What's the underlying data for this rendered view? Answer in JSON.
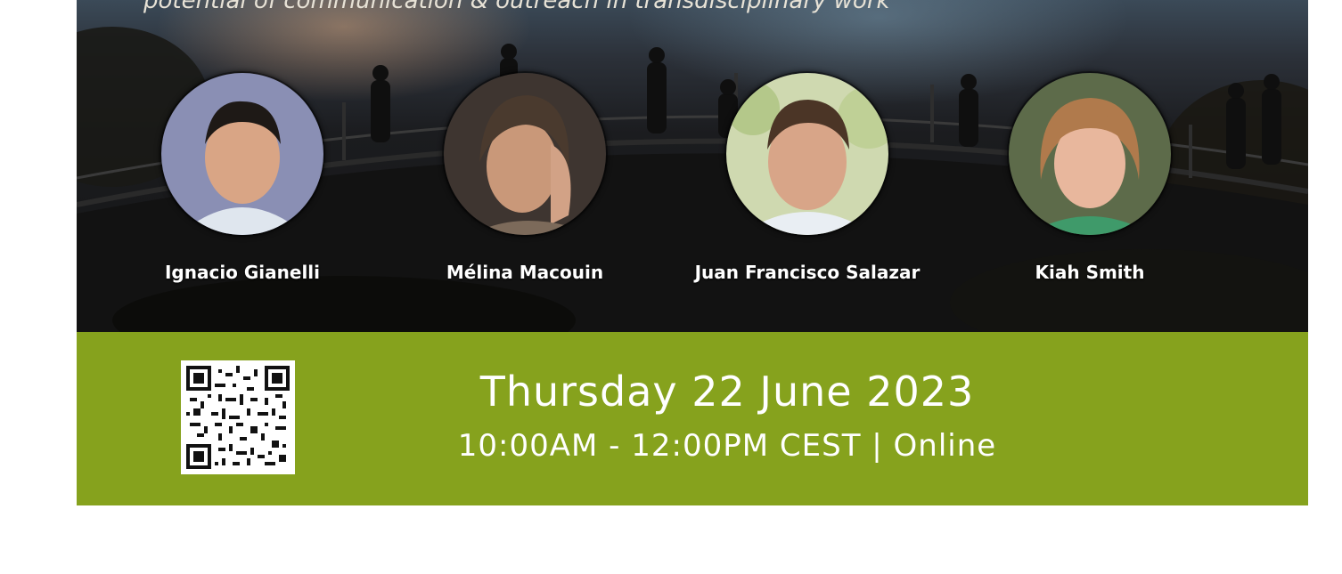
{
  "banner": {
    "tagline": "potential of communication & outreach in transdisciplinary work"
  },
  "speakers": [
    {
      "name": "Ignacio Gianelli"
    },
    {
      "name": "Mélina Macouin"
    },
    {
      "name": "Juan Francisco Salazar"
    },
    {
      "name": "Kiah Smith"
    }
  ],
  "event": {
    "date": "Thursday 22 June 2023",
    "time": "10:00AM - 12:00PM CEST | Online"
  },
  "colors": {
    "accent_green": "#86a21d",
    "text_white": "#ffffff"
  },
  "icons": {
    "qr": "qr-code-icon"
  }
}
